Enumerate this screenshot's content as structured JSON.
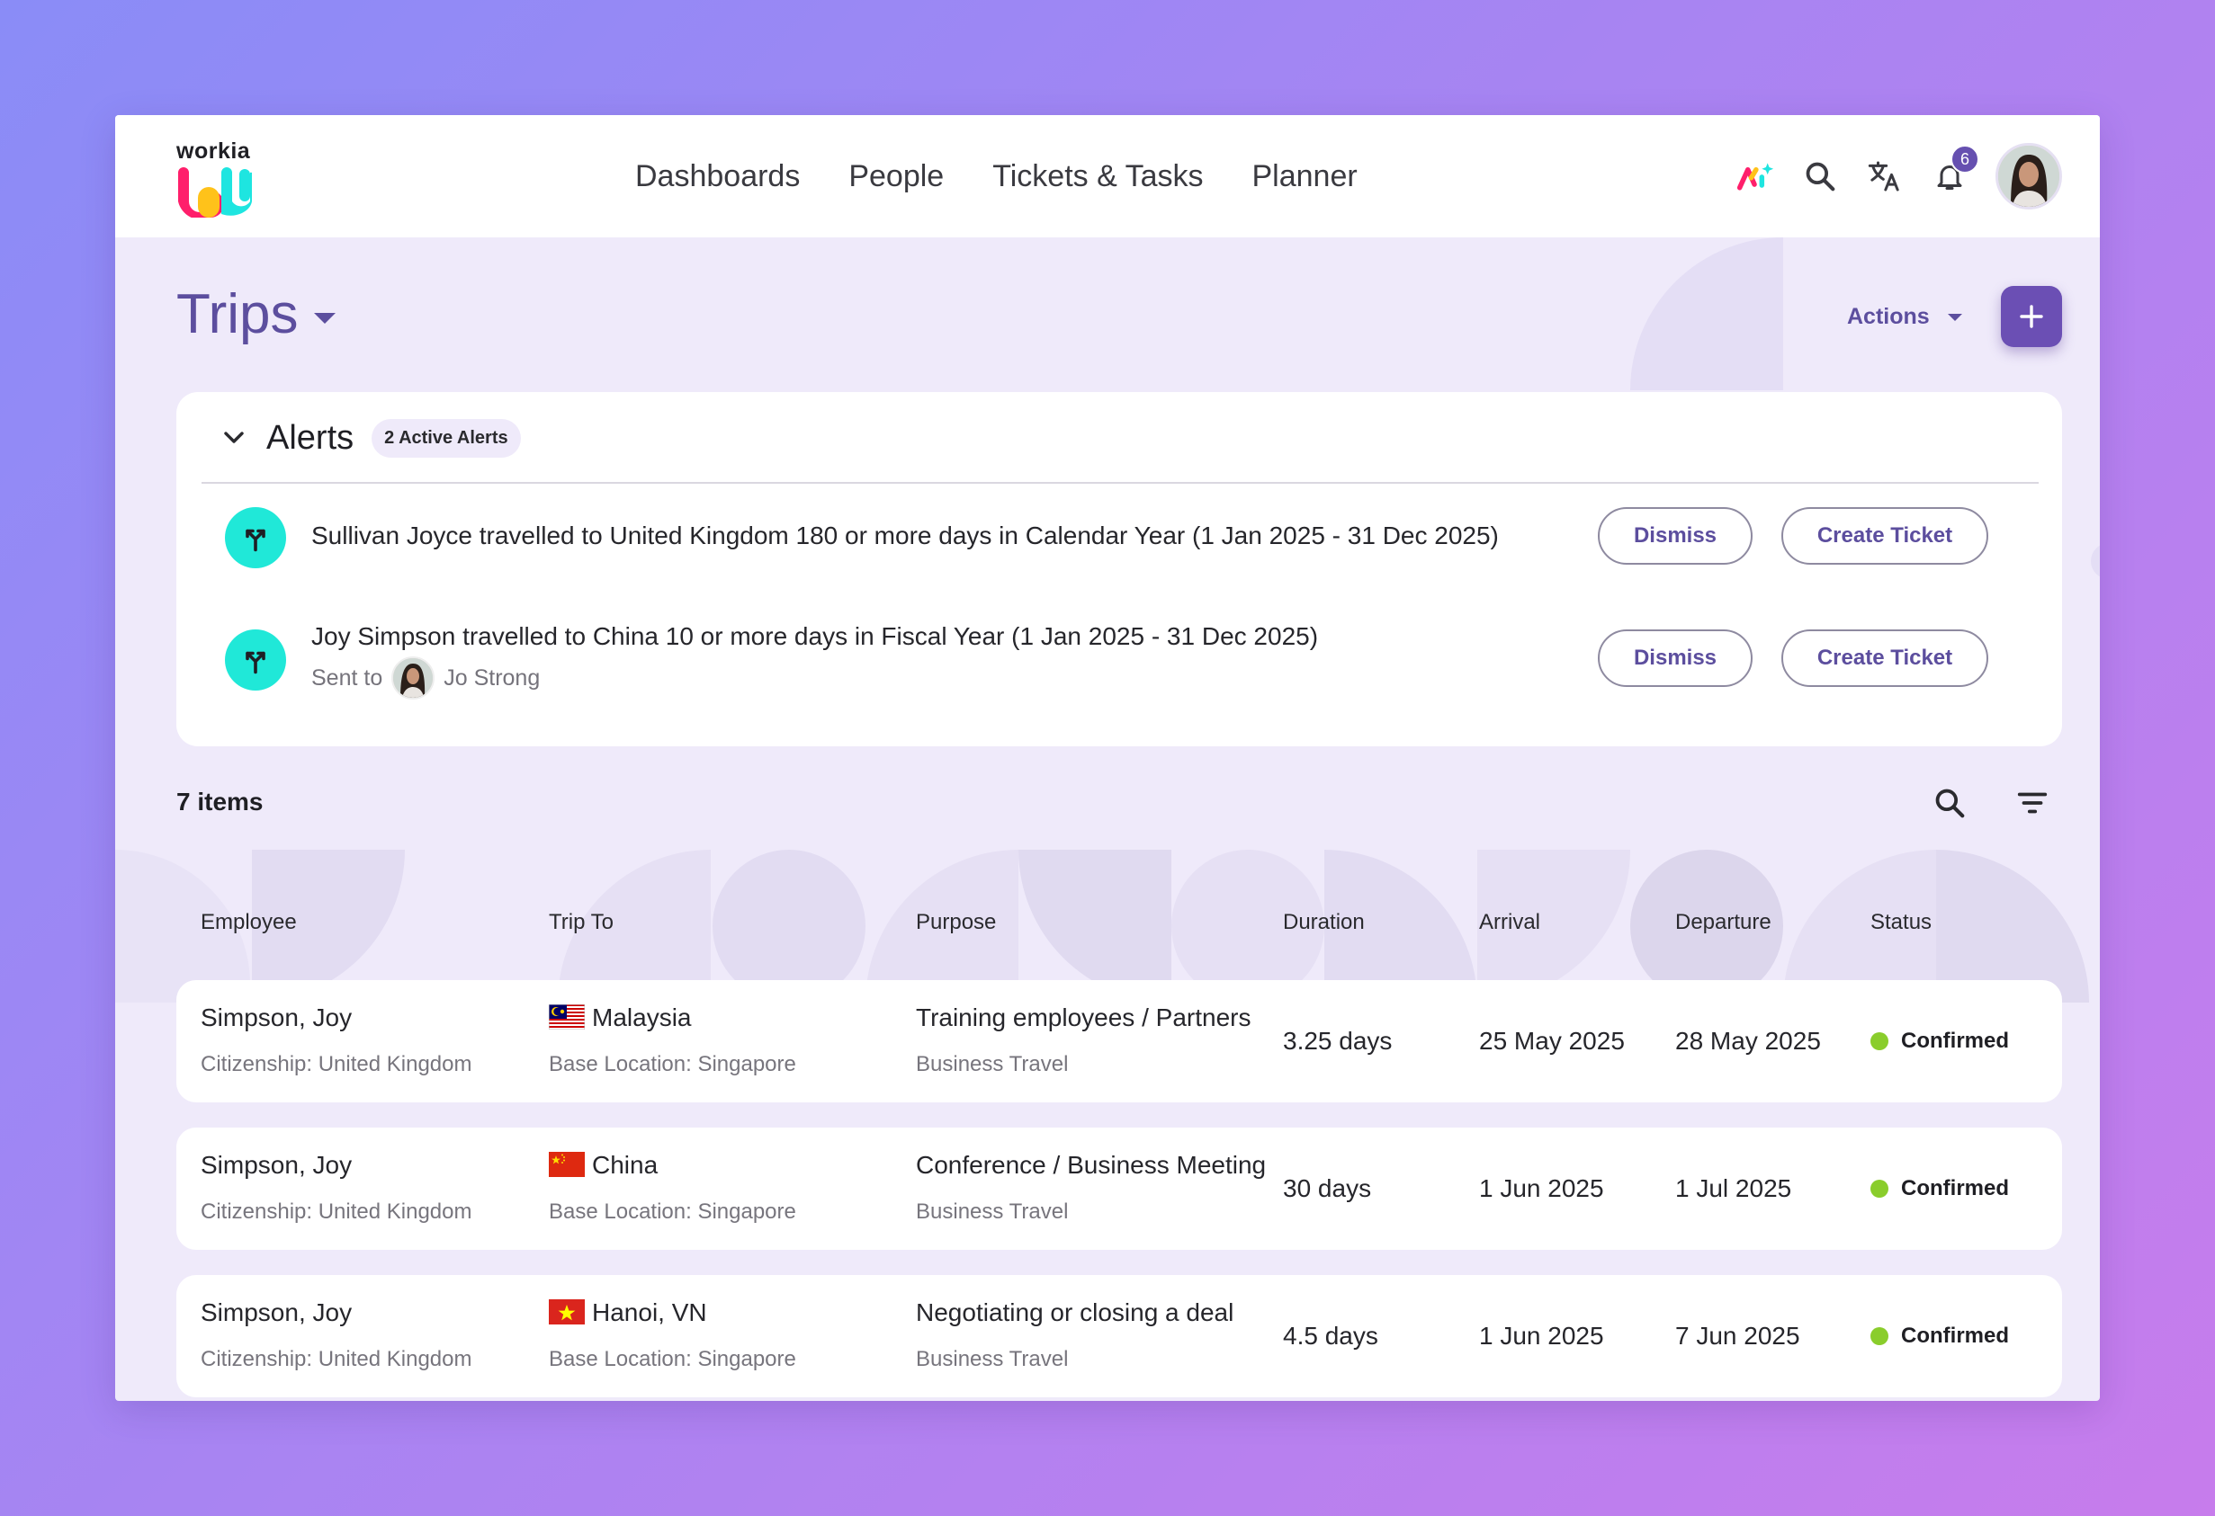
{
  "brand": {
    "name": "workia",
    "colors": {
      "pink": "#ff1f6b",
      "yellow": "#ffc21a",
      "cyan": "#1ee5e0",
      "accent": "#5c4e9e",
      "fab": "#6b4fb4"
    }
  },
  "nav": {
    "items": [
      "Dashboards",
      "People",
      "Tickets & Tasks",
      "Planner"
    ]
  },
  "topbar": {
    "notifications_count": "6",
    "icons": [
      "ai-sparkle-icon",
      "search-icon",
      "translate-icon",
      "bell-icon"
    ]
  },
  "page": {
    "title": "Trips",
    "actions_label": "Actions",
    "add_icon": "plus-icon"
  },
  "alerts": {
    "title": "Alerts",
    "badge": "2 Active Alerts",
    "items": [
      {
        "text": "Sullivan Joyce travelled to United Kingdom 180 or more days in Calendar Year (1 Jan 2025 - 31 Dec 2025)",
        "dismiss": "Dismiss",
        "create": "Create Ticket"
      },
      {
        "text": "Joy Simpson travelled to China 10 or more days in Fiscal Year (1 Jan 2025 - 31 Dec 2025)",
        "sent_to_label": "Sent to",
        "sent_to_name": "Jo Strong",
        "dismiss": "Dismiss",
        "create": "Create Ticket"
      }
    ]
  },
  "list": {
    "count": "7 items",
    "columns": [
      "Employee",
      "Trip To",
      "Purpose",
      "Duration",
      "Arrival",
      "Departure",
      "Status"
    ],
    "rows": [
      {
        "name": "Simpson, Joy",
        "citizenship": "Citizenship: United Kingdom",
        "flag": "malaysia",
        "trip_to": "Malaysia",
        "base": "Base Location: Singapore",
        "purpose": "Training employees / Partners",
        "purpose_type": "Business Travel",
        "duration": "3.25 days",
        "arrival": "25 May 2025",
        "departure": "28 May 2025",
        "status": "Confirmed"
      },
      {
        "name": "Simpson, Joy",
        "citizenship": "Citizenship: United Kingdom",
        "flag": "china",
        "trip_to": "China",
        "base": "Base Location: Singapore",
        "purpose": "Conference / Business Meeting",
        "purpose_type": "Business Travel",
        "duration": "30 days",
        "arrival": "1 Jun 2025",
        "departure": "1 Jul 2025",
        "status": "Confirmed"
      },
      {
        "name": "Simpson, Joy",
        "citizenship": "Citizenship: United Kingdom",
        "flag": "vietnam",
        "trip_to": "Hanoi, VN",
        "base": "Base Location: Singapore",
        "purpose": "Negotiating or closing a deal",
        "purpose_type": "Business Travel",
        "duration": "4.5 days",
        "arrival": "1 Jun 2025",
        "departure": "7 Jun 2025",
        "status": "Confirmed"
      }
    ]
  }
}
